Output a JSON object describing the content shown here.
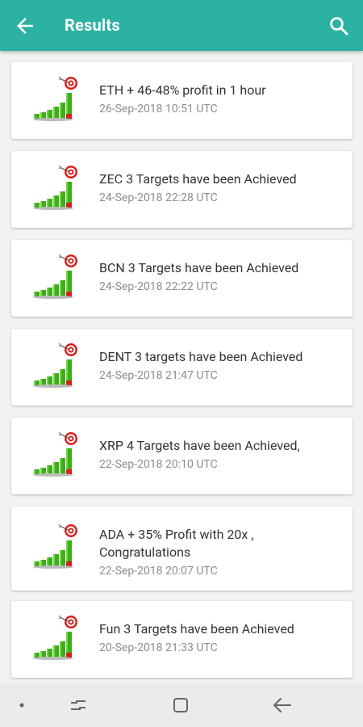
{
  "appbar": {
    "title": "Results"
  },
  "results": [
    {
      "headline": "ETH + 46-48% profit in 1 hour",
      "date": "26-Sep-2018 10:51  UTC"
    },
    {
      "headline": "ZEC 3 Targets have been Achieved",
      "date": "24-Sep-2018 22:28  UTC"
    },
    {
      "headline": "BCN 3 Targets have been Achieved",
      "date": "24-Sep-2018 22:22  UTC"
    },
    {
      "headline": "DENT  3 targets have been Achieved",
      "date": "24-Sep-2018 21:47  UTC"
    },
    {
      "headline": "XRP 4 Targets have been Achieved,",
      "date": "22-Sep-2018 20:10  UTC"
    },
    {
      "headline": "ADA + 35% Profit  with 20x  ,\nCongratulations",
      "date": "22-Sep-2018 20:07  UTC"
    },
    {
      "headline": "Fun 3 Targets have been Achieved",
      "date": "20-Sep-2018 21:33  UTC"
    }
  ],
  "colors": {
    "appbar": "#2bb2a3",
    "bar_green": "#3cae17",
    "bar_red": "#d81e1e",
    "target_red": "#d8201c"
  },
  "icons": {
    "back": "arrow-left-icon",
    "search": "search-icon",
    "thumbnail": "growth-chart-target-icon"
  },
  "system_nav": [
    "dot-icon",
    "recents-icon",
    "home-icon",
    "back-nav-icon"
  ]
}
